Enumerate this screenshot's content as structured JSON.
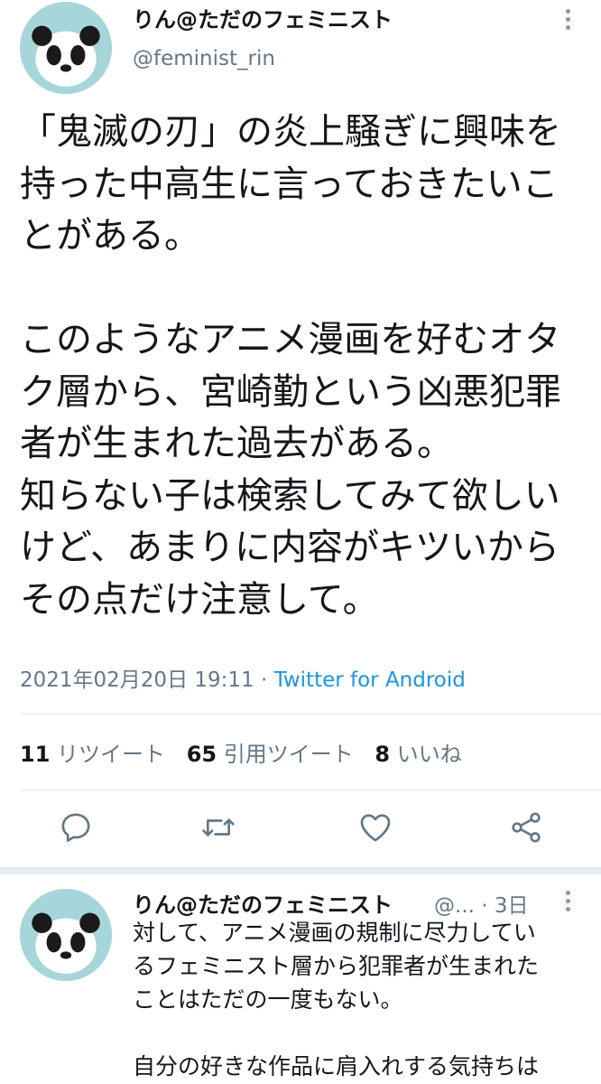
{
  "tweet": {
    "author_name": "りん@ただのフェミニスト",
    "author_handle": "@feminist_rin",
    "text_lines": [
      "「鬼滅の刃」の炎上騒ぎに興味を",
      "持った中高生に言っておきたいこ",
      "とがある。",
      "",
      "このようなアニメ漫画を好むオタ",
      "ク層から、宮崎勤という凶悪犯罪",
      "者が生まれた過去がある。",
      "知らない子は検索してみて欲しい",
      "けど、あまりに内容がキツいから",
      "その点だけ注意して。"
    ],
    "timestamp": "2021年02月20日 19:11",
    "separator": " · ",
    "source": "Twitter for Android",
    "stats": {
      "retweets_count": "11",
      "retweets_label": "リツイート",
      "quotes_count": "65",
      "quotes_label": "引用ツイート",
      "likes_count": "8",
      "likes_label": "いいね"
    },
    "actions": {
      "reply_icon": "reply-icon",
      "retweet_icon": "retweet-icon",
      "like_icon": "heart-icon",
      "share_icon": "share-icon"
    }
  },
  "reply": {
    "author_name": "りん@ただのフェミニスト",
    "author_handle": "@...",
    "time_ago": "3日",
    "separator": " · ",
    "text_lines": [
      "対して、アニメ漫画の規制に尽力してい",
      "るフェミニスト層から犯罪者が生まれた",
      "ことはただの一度もない。",
      "",
      "自分の好きな作品に肩入れする気持ちは"
    ]
  },
  "colors": {
    "link": "#1b95e0",
    "secondary_text": "#657786",
    "avatar_bg": "#a6d6da"
  }
}
